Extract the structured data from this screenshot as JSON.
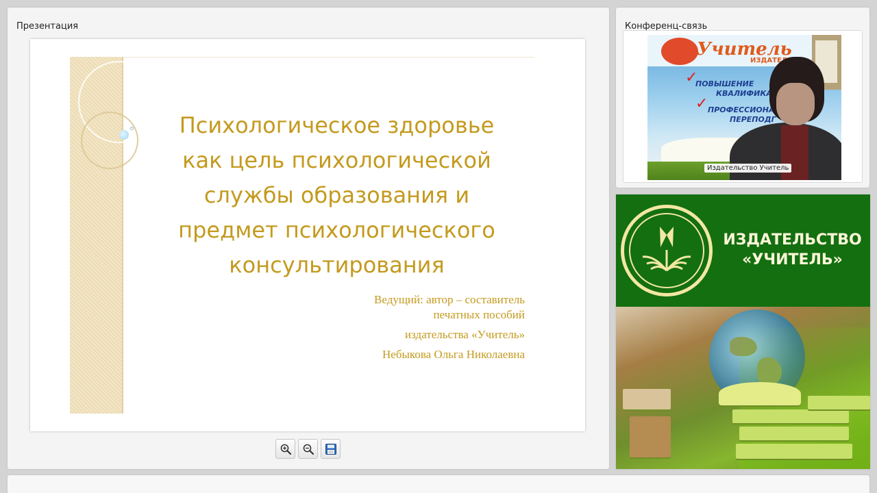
{
  "presentation_panel": {
    "title": "Презентация",
    "slide": {
      "title_lines": [
        "Психологическое здоровье",
        "как цель психологической",
        "службы образования и",
        "предмет психологического",
        "консультирования"
      ],
      "author_lines": [
        "Ведущий: автор – составитель",
        "печатных пособий",
        "издательства «Учитель»",
        "Небыкова Ольга Николаевна"
      ]
    },
    "toolbar": {
      "zoom_in_icon": "zoom-in-icon",
      "zoom_out_icon": "zoom-out-icon",
      "save_icon": "floppy-disk-icon"
    }
  },
  "conference_panel": {
    "title": "Конференц-связь",
    "video_caption": "Издательство Учитель",
    "video_background": {
      "brand": "Учитель",
      "brand_sub": "ИЗДАТЕЛЬ",
      "bullets": [
        "ПОВЫШЕНИЕ",
        "КВАЛИФИКА",
        "ПРОФЕССИОНА",
        "ПЕРЕПОДГ"
      ]
    }
  },
  "brand_panel": {
    "name_line1": "ИЗДАТЕЛЬСТВО",
    "name_line2": "«УЧИТЕЛЬ»"
  },
  "colors": {
    "slide_text": "#c49a1e",
    "brand_green": "#136f10",
    "brand_cream": "#f3e7a3"
  }
}
